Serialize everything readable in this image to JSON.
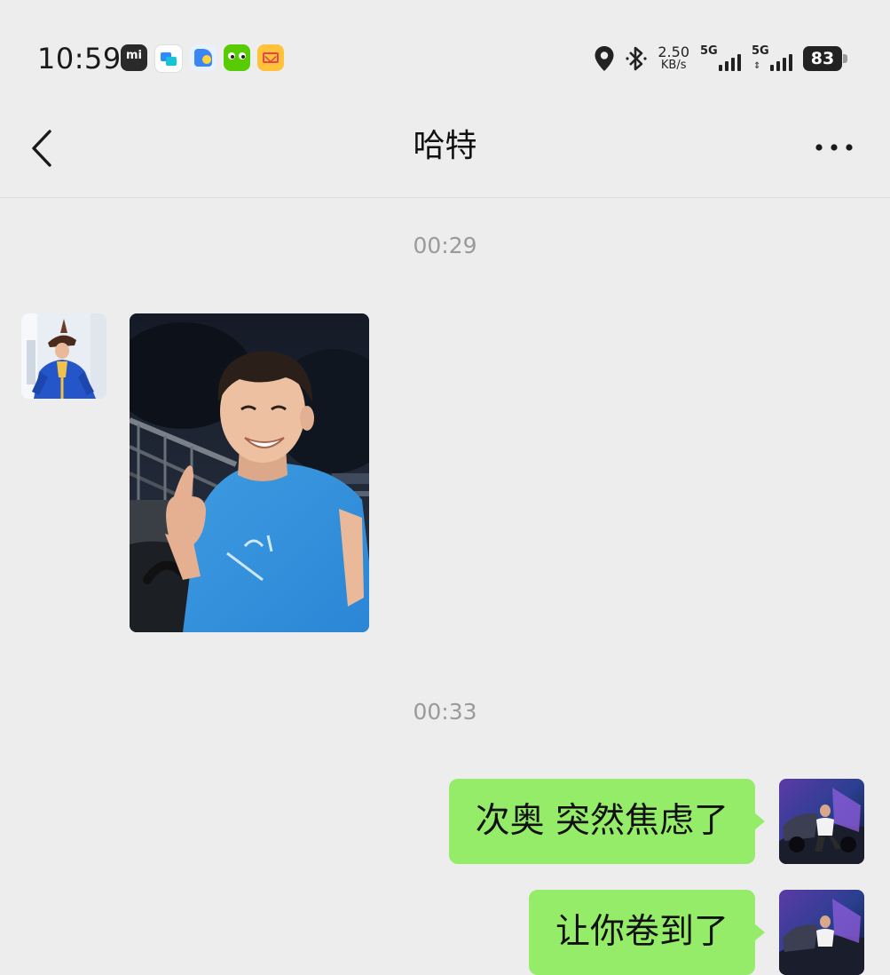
{
  "status_bar": {
    "time": "10:59",
    "network_speed_value": "2.50",
    "network_speed_unit": "KB/s",
    "sim1_label": "5G",
    "sim2_label": "5G",
    "battery_level": "83",
    "notification_icons": [
      "mi-icon",
      "messenger-icon",
      "files-icon",
      "duolingo-owl-icon",
      "mail-icon"
    ]
  },
  "header": {
    "title": "哈特"
  },
  "messages": [
    {
      "type": "timestamp",
      "text": "00:29"
    },
    {
      "type": "image",
      "from": "contact"
    },
    {
      "type": "timestamp",
      "text": "00:33"
    },
    {
      "type": "text",
      "from": "me",
      "text": "次奥 突然焦虑了"
    },
    {
      "type": "text",
      "from": "me",
      "text": "让你卷到了"
    }
  ],
  "colors": {
    "background": "#ededed",
    "outgoing_bubble": "#95ec69",
    "timestamp": "#9a9a9a"
  }
}
